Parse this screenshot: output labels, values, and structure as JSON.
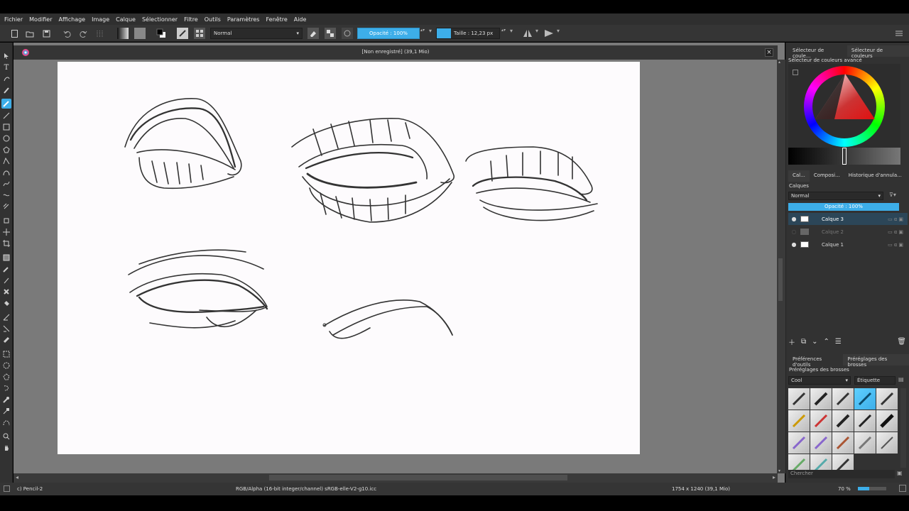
{
  "menu": [
    "Fichier",
    "Modifier",
    "Affichage",
    "Image",
    "Calque",
    "Sélectionner",
    "Filtre",
    "Outils",
    "Paramètres",
    "Fenêtre",
    "Aide"
  ],
  "toolbar": {
    "blend_mode": "Normal",
    "opacity_label": "Opacité : 100%",
    "size_label": "Taille : 12,23 px"
  },
  "document": {
    "title": "[Non enregistré] (39,1 Mio)"
  },
  "right_panel": {
    "top_tabs": [
      "Sélecteur de coule...",
      "Sélecteur de couleurs"
    ],
    "color_selector_title": "Sélecteur de couleurs avancé",
    "mid_tabs": [
      "Cal...",
      "Composi...",
      "Historique d'annula..."
    ],
    "layers_title": "Calques",
    "layer_blend": "Normal",
    "layer_opacity": "Opacité : 100%",
    "layers": [
      {
        "name": "Calque 3",
        "visible": true,
        "selected": true
      },
      {
        "name": "Calque 2",
        "visible": false,
        "selected": false
      },
      {
        "name": "Calque 1",
        "visible": true,
        "selected": false
      }
    ],
    "bottom_tabs": [
      "Préférences d'outils",
      "Préréglages des brosses"
    ],
    "presets_title": "Préréglages des brosses",
    "preset_filter": "Cool",
    "tag_label": "Étiquette",
    "search_placeholder": "Chercher"
  },
  "status": {
    "brush": "c) Pencil-2",
    "color_space": "RGB/Alpha (16-bit integer/channel)  sRGB-elle-V2-g10.icc",
    "image_size": "1754 x 1240 (39,1 Mio)",
    "zoom": "70 %",
    "zoom_fraction": 0.4
  },
  "colors": {
    "accent": "#3daee9",
    "panel_bg": "#323232",
    "canvas_bg": "#7a7a7a"
  }
}
